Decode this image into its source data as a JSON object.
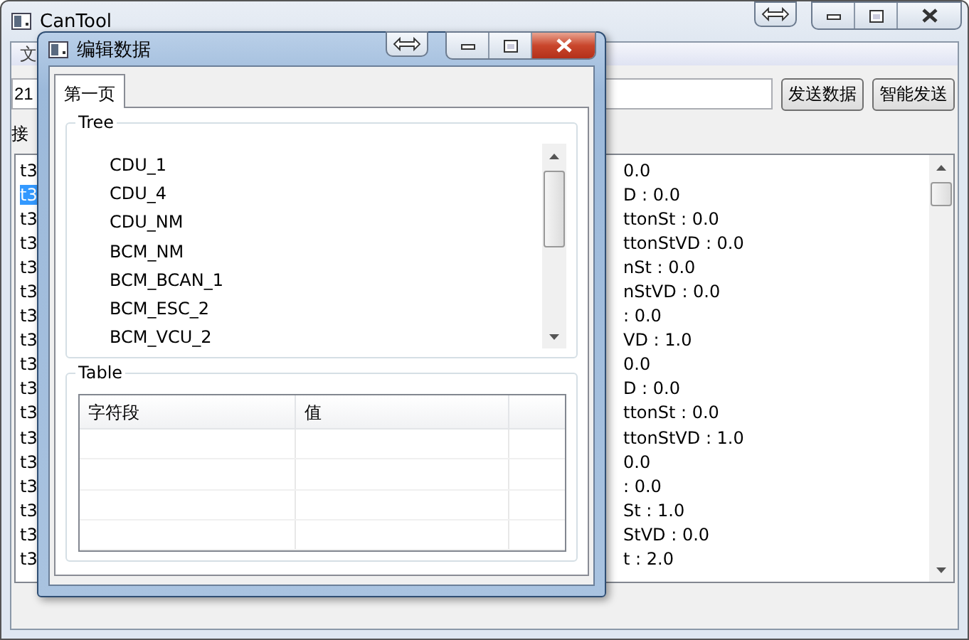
{
  "main_window": {
    "title": "CanTool",
    "menu": [
      "文"
    ],
    "input": {
      "value": "21"
    },
    "buttons": [
      "发送数据",
      "智能发送"
    ],
    "label": "接",
    "list": {
      "rows": [
        {
          "start": "t3",
          "end": "0.0",
          "selected": false
        },
        {
          "start": "t3",
          "end": "D : 0.0",
          "selected": true
        },
        {
          "start": "t3",
          "end": "ttonSt : 0.0",
          "selected": false
        },
        {
          "start": "t3",
          "end": "ttonStVD : 0.0",
          "selected": false
        },
        {
          "start": "t3",
          "end": "nSt : 0.0",
          "selected": false
        },
        {
          "start": "t3",
          "end": "nStVD : 0.0",
          "selected": false
        },
        {
          "start": "t3",
          "end": ": 0.0",
          "selected": false
        },
        {
          "start": "t3",
          "end": "VD : 1.0",
          "selected": false
        },
        {
          "start": "t3",
          "end": "0.0",
          "selected": false
        },
        {
          "start": "t3",
          "end": "D : 0.0",
          "selected": false
        },
        {
          "start": "t3",
          "end": "ttonSt : 0.0",
          "selected": false
        },
        {
          "start": "t3",
          "end": "ttonStVD : 1.0",
          "selected": false
        },
        {
          "start": "t3",
          "end": "0.0",
          "selected": false
        },
        {
          "start": "t3",
          "end": ": 0.0",
          "selected": false
        },
        {
          "start": "t3",
          "end": "St : 1.0",
          "selected": false
        },
        {
          "start": "t3",
          "end": "StVD : 0.0",
          "selected": false
        },
        {
          "start": "t3",
          "end": "t : 2.0",
          "selected": false
        }
      ]
    }
  },
  "dialog": {
    "title": "编辑数据",
    "tabs": [
      {
        "label": "第一页",
        "selected": true
      }
    ],
    "tree": {
      "title": "Tree",
      "items": [
        "CDU_1",
        "CDU_4",
        "CDU_NM",
        "BCM_NM",
        "BCM_BCAN_1",
        "BCM_ESC_2",
        "BCM_VCU_2"
      ]
    },
    "table": {
      "title": "Table",
      "columns": [
        "字符段",
        "值"
      ]
    }
  }
}
